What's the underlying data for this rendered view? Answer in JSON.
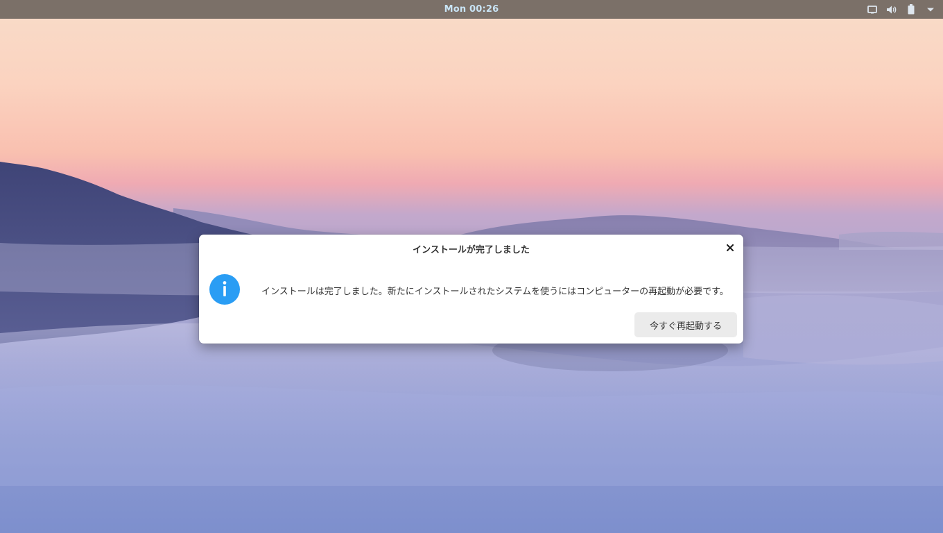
{
  "topbar": {
    "clock": "Mon 00:26",
    "tray_icons": [
      "display-icon",
      "volume-icon",
      "battery-icon",
      "menu-arrow-icon"
    ]
  },
  "dialog": {
    "title": "インストールが完了しました",
    "message": "インストールは完了しました。新たにインストールされたシステムを使うにはコンピューターの再起動が必要です。",
    "restart_button": "今すぐ再起動する",
    "icon": "info-icon",
    "close_icon": "close-icon"
  },
  "colors": {
    "topbar_bg": "#7b7068",
    "clock_text": "#c9e4f5",
    "info_blue": "#2a9df4",
    "button_bg": "#ebebeb"
  }
}
